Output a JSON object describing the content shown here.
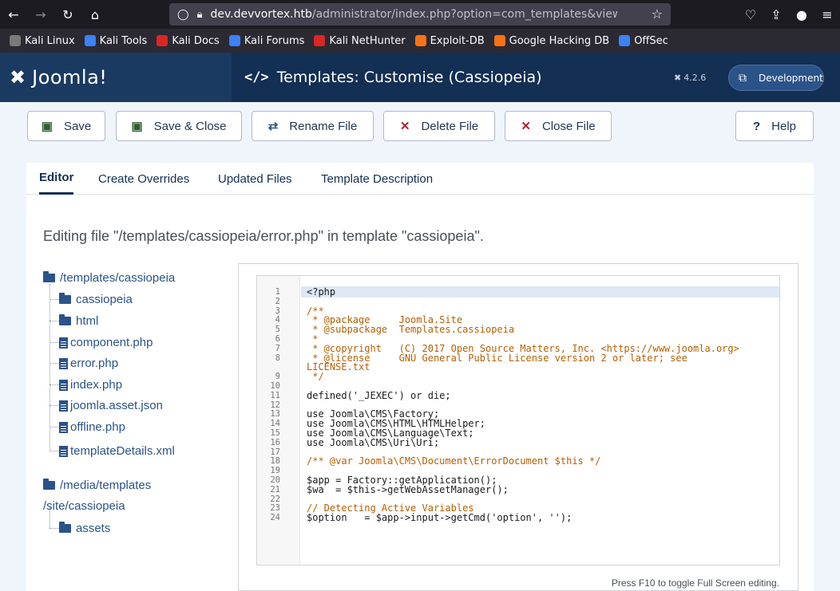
{
  "browser": {
    "url_host": "dev.devvortex.htb",
    "url_path": "/administrator/index.php?option=com_templates&view=tem",
    "bookmarks": [
      "Kali Linux",
      "Kali Tools",
      "Kali Docs",
      "Kali Forums",
      "Kali NetHunter",
      "Exploit-DB",
      "Google Hacking DB",
      "OffSec"
    ],
    "bookmark_colors": [
      "#7a7a7a",
      "#3b82f6",
      "#dc2626",
      "#3b82f6",
      "#dc2626",
      "#f97316",
      "#f97316",
      "#3b82f6"
    ]
  },
  "header": {
    "logo": "Joomla!",
    "title": "Templates: Customise (Cassiopeia)",
    "version": "4.2.6",
    "dev_label": "Development"
  },
  "toolbar": {
    "save": "Save",
    "save_close": "Save & Close",
    "rename": "Rename File",
    "delete": "Delete File",
    "close": "Close File",
    "help": "Help"
  },
  "tabs": [
    "Editor",
    "Create Overrides",
    "Updated Files",
    "Template Description"
  ],
  "editing_text": "Editing file \"/templates/cassiopeia/error.php\" in template \"cassiopeia\".",
  "tree": {
    "root": "/templates/cassiopeia",
    "folders": [
      "cassiopeia",
      "html"
    ],
    "files": [
      "component.php",
      "error.php",
      "index.php",
      "joomla.asset.json",
      "offline.php",
      "templateDetails.xml"
    ],
    "media_root_1": "/media/templates",
    "media_root_2": "/site/cassiopeia",
    "media_folder": "assets"
  },
  "code_lines": [
    {
      "n": "1",
      "t": "<?php"
    },
    {
      "n": "2",
      "t": ""
    },
    {
      "n": "3",
      "t": "/**"
    },
    {
      "n": "4",
      "t": " * @package     Joomla.Site"
    },
    {
      "n": "5",
      "t": " * @subpackage  Templates.cassiopeia"
    },
    {
      "n": "6",
      "t": " *"
    },
    {
      "n": "7",
      "t": " * @copyright   (C) 2017 Open Source Matters, Inc. <https://www.joomla.org>"
    },
    {
      "n": "8",
      "t": " * @license     GNU General Public License version 2 or later; see"
    },
    {
      "n": "",
      "t": "LICENSE.txt"
    },
    {
      "n": "9",
      "t": " */"
    },
    {
      "n": "10",
      "t": ""
    },
    {
      "n": "11",
      "t": "defined('_JEXEC') or die;"
    },
    {
      "n": "12",
      "t": ""
    },
    {
      "n": "13",
      "t": "use Joomla\\CMS\\Factory;"
    },
    {
      "n": "14",
      "t": "use Joomla\\CMS\\HTML\\HTMLHelper;"
    },
    {
      "n": "15",
      "t": "use Joomla\\CMS\\Language\\Text;"
    },
    {
      "n": "16",
      "t": "use Joomla\\CMS\\Uri\\Uri;"
    },
    {
      "n": "17",
      "t": ""
    },
    {
      "n": "18",
      "t": "/** @var Joomla\\CMS\\Document\\ErrorDocument $this */"
    },
    {
      "n": "19",
      "t": ""
    },
    {
      "n": "20",
      "t": "$app = Factory::getApplication();"
    },
    {
      "n": "21",
      "t": "$wa  = $this->getWebAssetManager();"
    },
    {
      "n": "22",
      "t": ""
    },
    {
      "n": "23",
      "t": "// Detecting Active Variables"
    },
    {
      "n": "24",
      "t": "$option   = $app->input->getCmd('option', '');"
    }
  ],
  "hint": "Press F10 to toggle Full Screen editing."
}
